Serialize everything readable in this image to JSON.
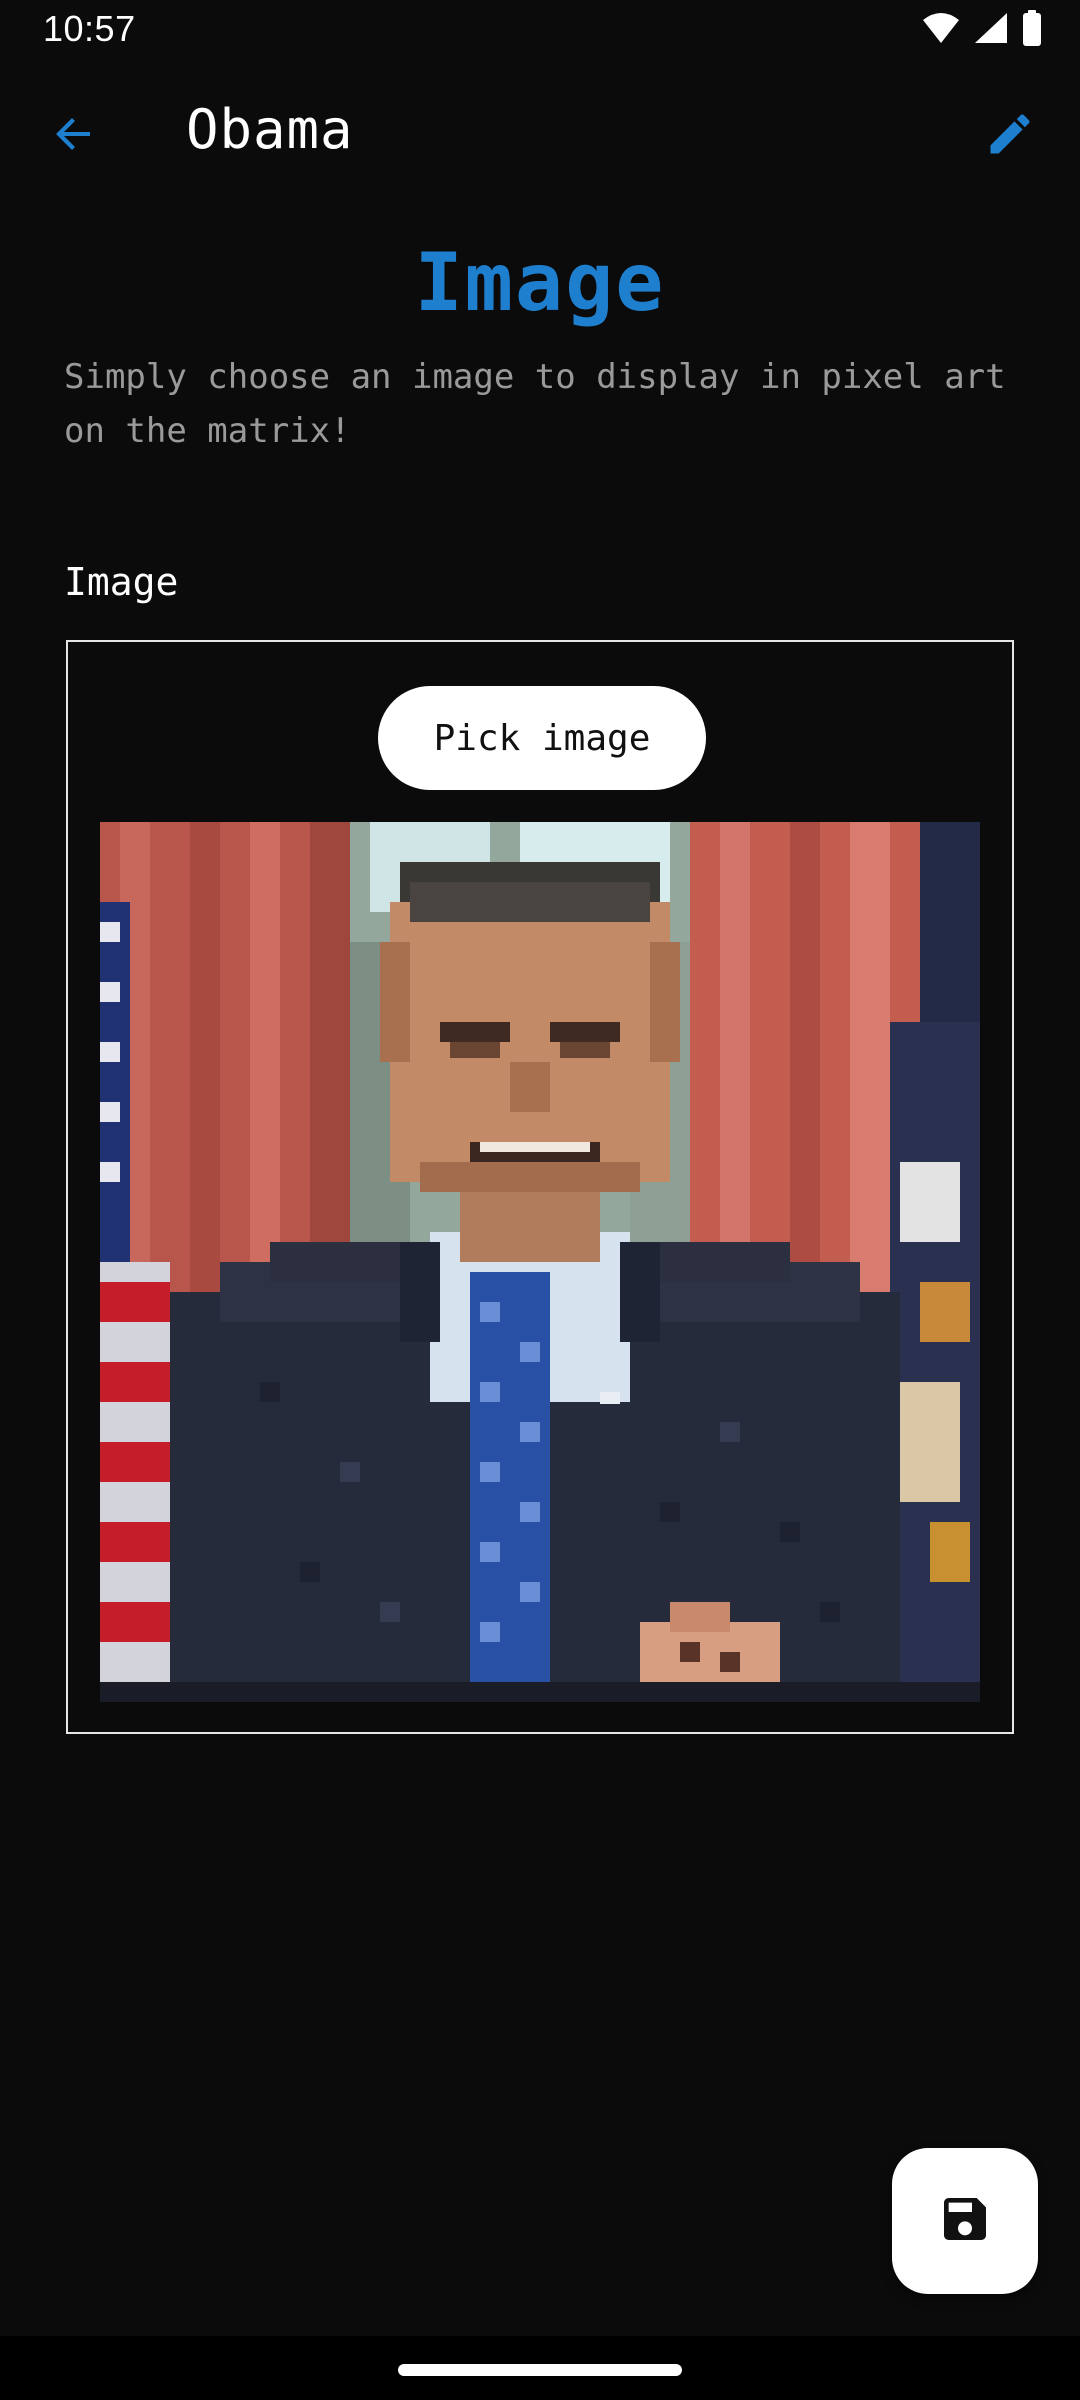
{
  "status_bar": {
    "time": "10:57",
    "icons": [
      "wifi-icon",
      "signal-icon",
      "battery-icon"
    ]
  },
  "app_bar": {
    "title": "Obama",
    "back_icon": "arrow-back-icon",
    "edit_icon": "pencil-icon"
  },
  "section": {
    "heading": "Image",
    "description": "Simply choose an image to display in pixel art on the matrix!"
  },
  "image_field": {
    "label": "Image",
    "pick_button_label": "Pick image"
  },
  "fab": {
    "icon": "save-icon"
  },
  "colors": {
    "accent": "#1f7fcf",
    "background": "#0b0b0c",
    "description_text": "#9a9a9a",
    "fab_background": "#ffffff"
  }
}
